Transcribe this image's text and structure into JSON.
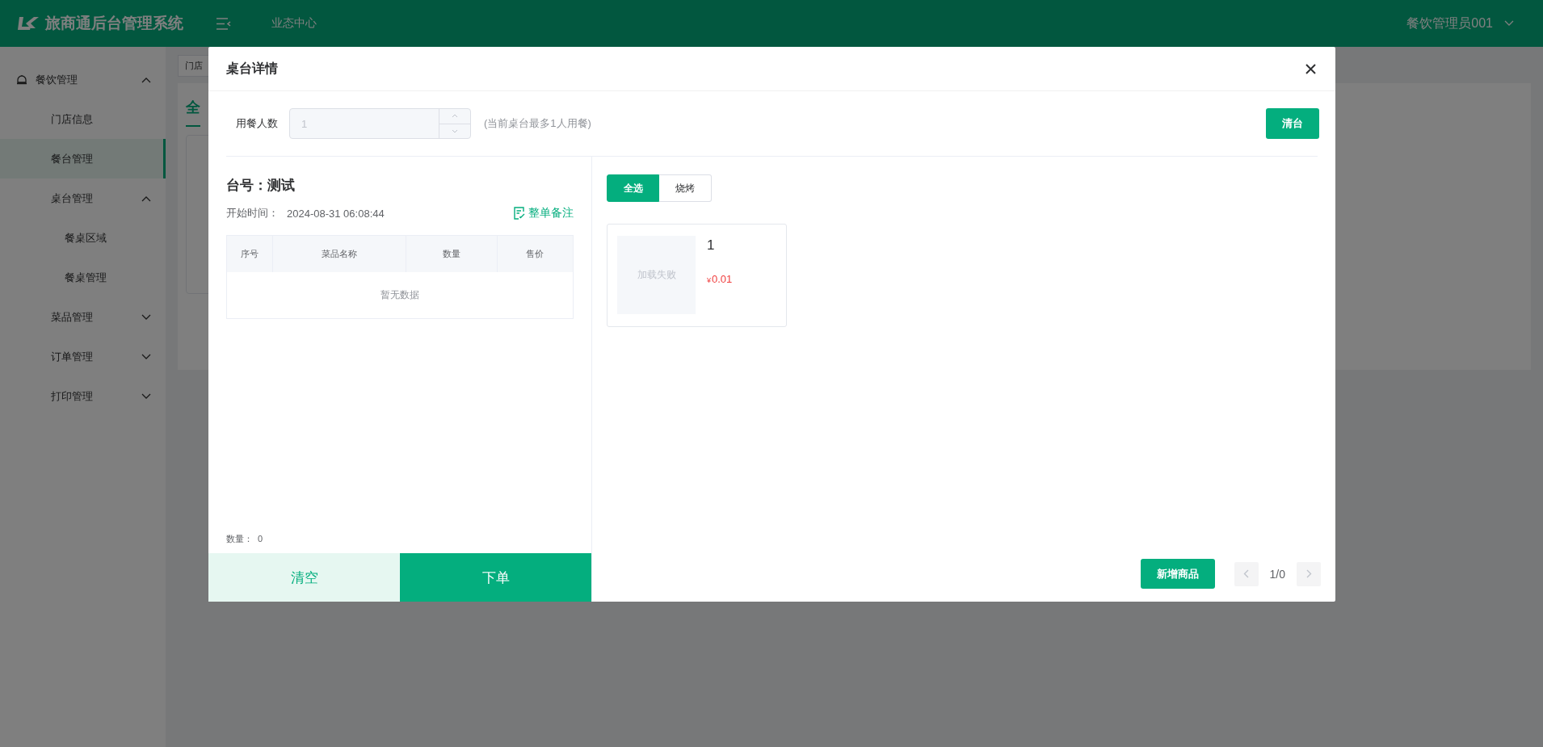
{
  "header": {
    "title": "旅商通后台管理系统",
    "nav": "业态中心",
    "user": "餐饮管理员001"
  },
  "sidebar": {
    "items": [
      {
        "label": "餐饮管理",
        "expanded": true,
        "selected": false,
        "children": [
          {
            "label": "门店信息",
            "selected": false
          },
          {
            "label": "餐台管理",
            "selected": true
          },
          {
            "label": "桌台管理",
            "expanded": true,
            "selected": false,
            "children": [
              {
                "label": "餐桌区域",
                "selected": false
              },
              {
                "label": "餐桌管理",
                "selected": false
              }
            ]
          },
          {
            "label": "菜品管理",
            "expanded": false,
            "selected": false
          },
          {
            "label": "订单管理",
            "expanded": false,
            "selected": false
          },
          {
            "label": "打印管理",
            "expanded": false,
            "selected": false
          }
        ]
      }
    ]
  },
  "main": {
    "breadcrumb_tab": "门店",
    "content_tab": "全"
  },
  "modal": {
    "title": "桌台详情",
    "guests": {
      "label": "用餐人数",
      "value": "1",
      "disabled": true,
      "hint": "(当前桌台最多1人用餐)"
    },
    "clear_table_button": "清台",
    "order": {
      "table": "台号：测试",
      "start_label": "开始时间：",
      "start_time": "2024-08-31 06:08:44",
      "note_link": "整单备注",
      "columns": [
        "序号",
        "菜品名称",
        "数量",
        "售价"
      ],
      "empty_text": "暂无数据",
      "count_label": "数量：",
      "count": "0",
      "clear_button": "清空",
      "submit_button": "下单"
    },
    "menu": {
      "categories": [
        {
          "label": "全选",
          "selected": true
        },
        {
          "label": "烧烤",
          "selected": false
        }
      ],
      "products": [
        {
          "name": "1",
          "image_text": "加载失败",
          "currency": "¥",
          "price": "0.01"
        }
      ],
      "add_button": "新增商品",
      "pager": "1/0"
    }
  }
}
